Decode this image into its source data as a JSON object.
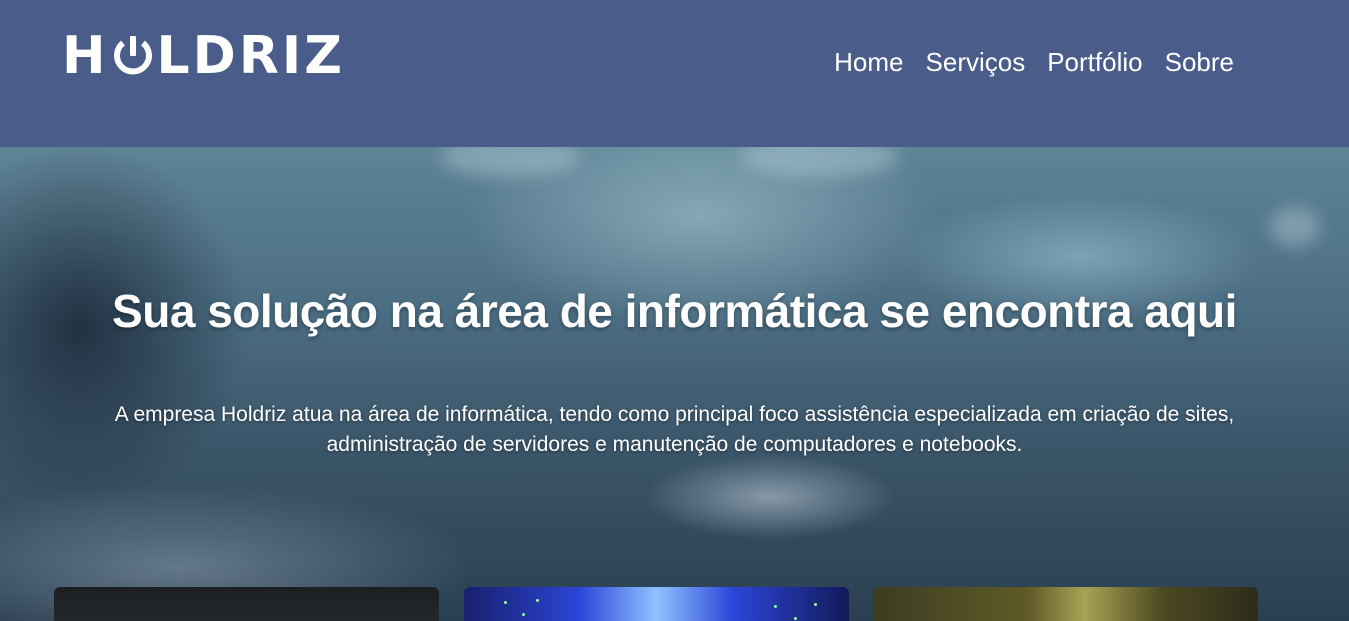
{
  "brand": {
    "logo_text_before": "H",
    "logo_text_after": "LDRIZ",
    "logo_alt": "HOLDRIZ"
  },
  "nav": {
    "items": [
      {
        "label": "Home"
      },
      {
        "label": "Serviços"
      },
      {
        "label": "Portfólio"
      },
      {
        "label": "Sobre"
      }
    ]
  },
  "hero": {
    "title": "Sua solução na área de informática se encontra aqui",
    "description_line1": "A empresa Holdriz atua na área de informática, tendo como principal foco assistência especializada em criação de sites,",
    "description_line2": "administração de servidores e manutenção de computadores e notebooks."
  },
  "colors": {
    "header_bg": "#4a5d8a",
    "text": "#ffffff"
  },
  "icons": {
    "logo_o": "power-icon"
  }
}
